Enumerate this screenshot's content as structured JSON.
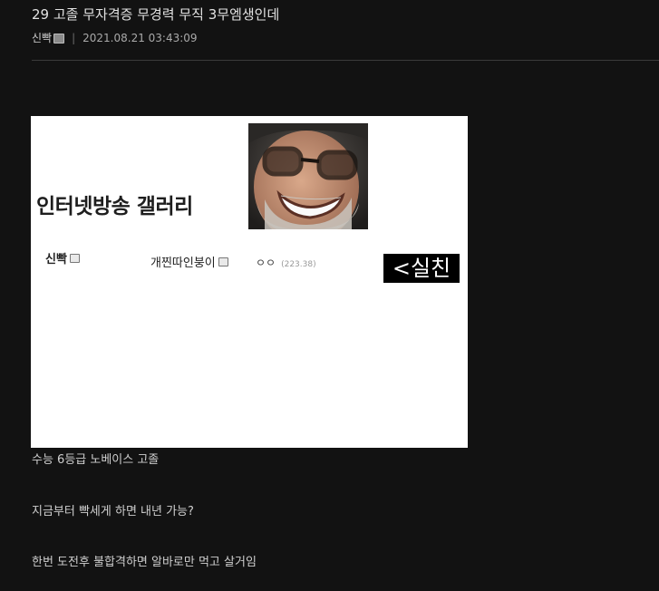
{
  "post": {
    "title": "29 고졸 무자격증 무경력 무직 3무엠생인데",
    "author": "신빡",
    "datetime": "2021.08.21 03:43:09"
  },
  "image": {
    "gallery_name": "인터넷방송 갤러리",
    "commenters": [
      {
        "nick": "신빡",
        "icon": "gallog-icon"
      },
      {
        "nick": "개찐따인붕이",
        "icon": "gallog-icon"
      }
    ],
    "comment_text": "ㅇㅇ",
    "comment_ip": "(223.38)",
    "caption": "<실친",
    "face": "laughing-man-photo"
  },
  "body_lines": [
    "수능 6등급 노베이스 고졸",
    "지금부터 빡세게 하면 내년 가능?",
    "한번 도전후 불합격하면 알바로만 먹고 살거임"
  ]
}
